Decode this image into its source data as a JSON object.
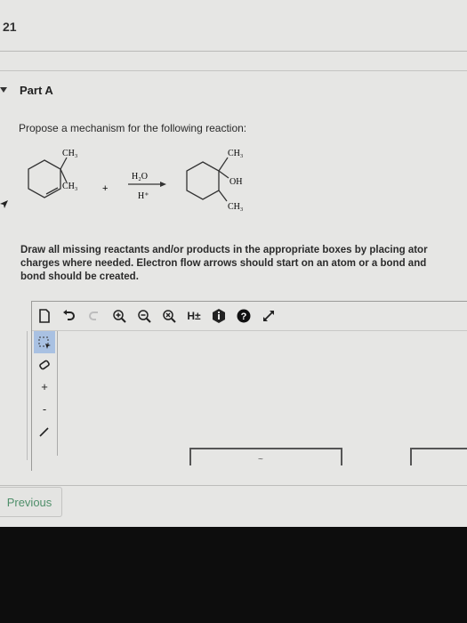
{
  "question": {
    "number": "21"
  },
  "part": {
    "label": "Part A"
  },
  "prompt": "Propose a mechanism for the following reaction:",
  "reaction": {
    "reactant": {
      "substituents": [
        "CH₃",
        "CH₃"
      ]
    },
    "plus": "+",
    "reagent_top": "H₂O",
    "reagent_bottom": "H⁺",
    "product": {
      "substituents": [
        "CH₃",
        "OH",
        "CH₃"
      ]
    }
  },
  "instructions": "Draw all missing reactants and/or products in the appropriate boxes by placing atoms... charges where needed. Electron flow arrows should start on an atom or a bond and... bond should be created.",
  "instructions_lines": [
    "Draw all missing reactants and/or products in the appropriate boxes by placing ator",
    "charges where needed. Electron flow arrows should start on an atom or a bond and",
    "bond should be created."
  ],
  "toolbar": {
    "items": [
      {
        "name": "new-document-icon",
        "glyph": "🗋",
        "disabled": false
      },
      {
        "name": "undo-icon",
        "glyph": "↶",
        "disabled": false
      },
      {
        "name": "redo-icon",
        "glyph": "↷",
        "disabled": true
      },
      {
        "name": "zoom-in-icon",
        "glyph": "⊕",
        "disabled": false
      },
      {
        "name": "zoom-out-icon",
        "glyph": "⊖",
        "disabled": false
      },
      {
        "name": "zoom-reset-icon",
        "glyph": "⊗",
        "disabled": false
      },
      {
        "name": "hydrogen-toggle-icon",
        "glyph": "H±",
        "disabled": false
      },
      {
        "name": "info-icon",
        "glyph": "⬢",
        "disabled": false
      },
      {
        "name": "help-icon",
        "glyph": "?",
        "disabled": false
      },
      {
        "name": "fullscreen-icon",
        "glyph": "⤢",
        "disabled": false
      }
    ]
  },
  "sidebar": {
    "items": [
      {
        "name": "selection-tool-icon",
        "glyph": "⬚",
        "selected": true
      },
      {
        "name": "eraser-tool-icon",
        "glyph": "⌫",
        "selected": false
      },
      {
        "name": "positive-charge-icon",
        "glyph": "+",
        "selected": false
      },
      {
        "name": "negative-charge-icon",
        "glyph": "-",
        "selected": false
      },
      {
        "name": "bond-tool-icon",
        "glyph": "/",
        "selected": false
      }
    ]
  },
  "canvas": {
    "box_label": "~"
  },
  "nav": {
    "previous_label": "Previous"
  }
}
